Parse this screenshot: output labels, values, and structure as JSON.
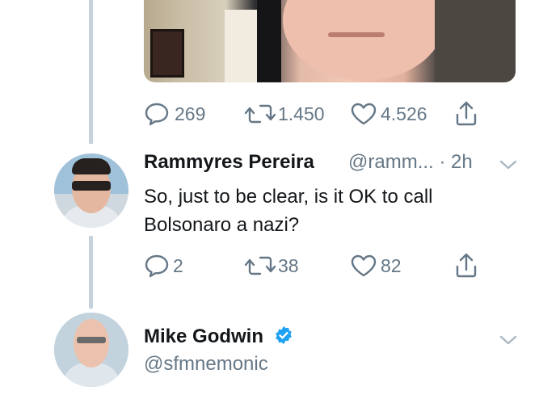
{
  "tweet_top": {
    "actions": {
      "replies": "269",
      "retweets": "1.450",
      "likes": "4.526"
    }
  },
  "reply_tweet": {
    "name": "Rammyres Pereira",
    "handle": "@ramm...",
    "separator": "·",
    "time": "2h",
    "text_line1": "So, just to be clear, is it OK to call",
    "text_line2": "Bolsonaro a nazi?",
    "actions": {
      "replies": "2",
      "retweets": "38",
      "likes": "82"
    }
  },
  "main_tweet": {
    "name": "Mike Godwin",
    "handle": "@sfmnemonic",
    "verified": true
  },
  "colors": {
    "text_primary": "#14171a",
    "text_secondary": "#657786",
    "verified_blue": "#1da1f2",
    "thread_line": "#c7d3dc"
  },
  "icons": [
    "reply-icon",
    "retweet-icon",
    "like-icon",
    "share-icon",
    "chevron-down-icon",
    "verified-badge-icon"
  ]
}
